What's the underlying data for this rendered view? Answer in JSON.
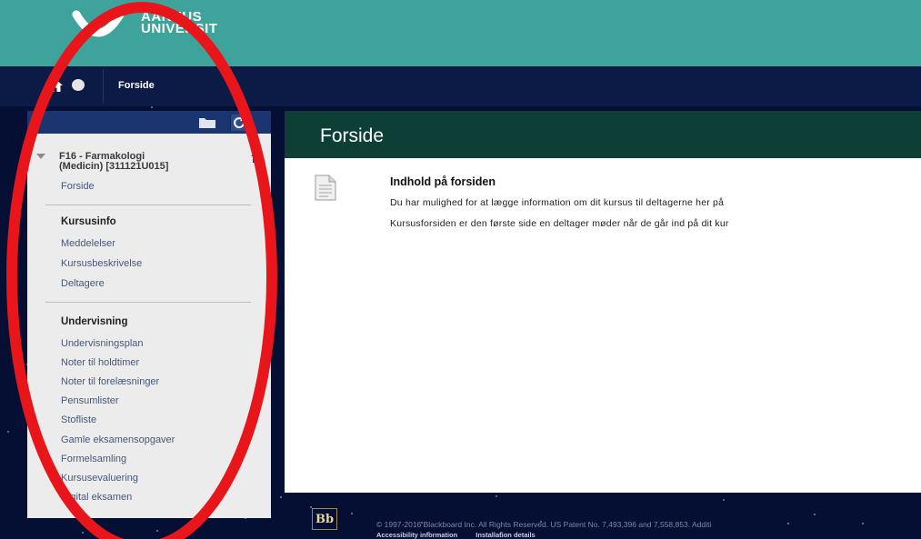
{
  "header": {
    "logo_line1": "AARHUS",
    "logo_line2": "UNIVERSIT"
  },
  "topnav": {
    "icons": [
      "home-icon",
      "circle-icon"
    ],
    "breadcrumb": "Forside"
  },
  "sidebar": {
    "tool_icons": [
      "folder-icon",
      "refresh-icon"
    ],
    "course_title_line1": "F16 - Farmakologi",
    "course_title_line2": "(Medicin) [311121U015]",
    "course_link": "Forside",
    "sections": [
      {
        "heading": "Kursusinfo",
        "items": [
          "Meddelelser",
          "Kursusbeskrivelse",
          "Deltagere"
        ]
      },
      {
        "heading": "Undervisning",
        "items": [
          "Undervisningsplan",
          "Noter til holdtimer",
          "Noter til forelæsninger",
          "Pensumlister",
          "Stofliste",
          "Gamle eksamensopgaver",
          "Formelsamling",
          "Kursusevaluering",
          "Digital eksamen"
        ]
      }
    ]
  },
  "content": {
    "title": "Forside",
    "block_title": "Indhold på forsiden",
    "line1": "Du har mulighed for at lægge information om dit kursus til deltagerne her på",
    "line2": "Kursusforsiden er den første side en deltager møder når de går ind på dit kur"
  },
  "footer": {
    "bb_logo": "Bb",
    "copyright": "© 1997-2016 Blackboard Inc. All Rights Reserved. US Patent No. 7,493,396 and 7,558,853. Additi",
    "link1": "Accessibility information",
    "link2": "Installation details"
  },
  "colors": {
    "header_teal": "#3ea49b",
    "nav_navy": "#0c1a46",
    "title_bar_green": "#0d3f36",
    "annotation_red": "#e8161b"
  }
}
